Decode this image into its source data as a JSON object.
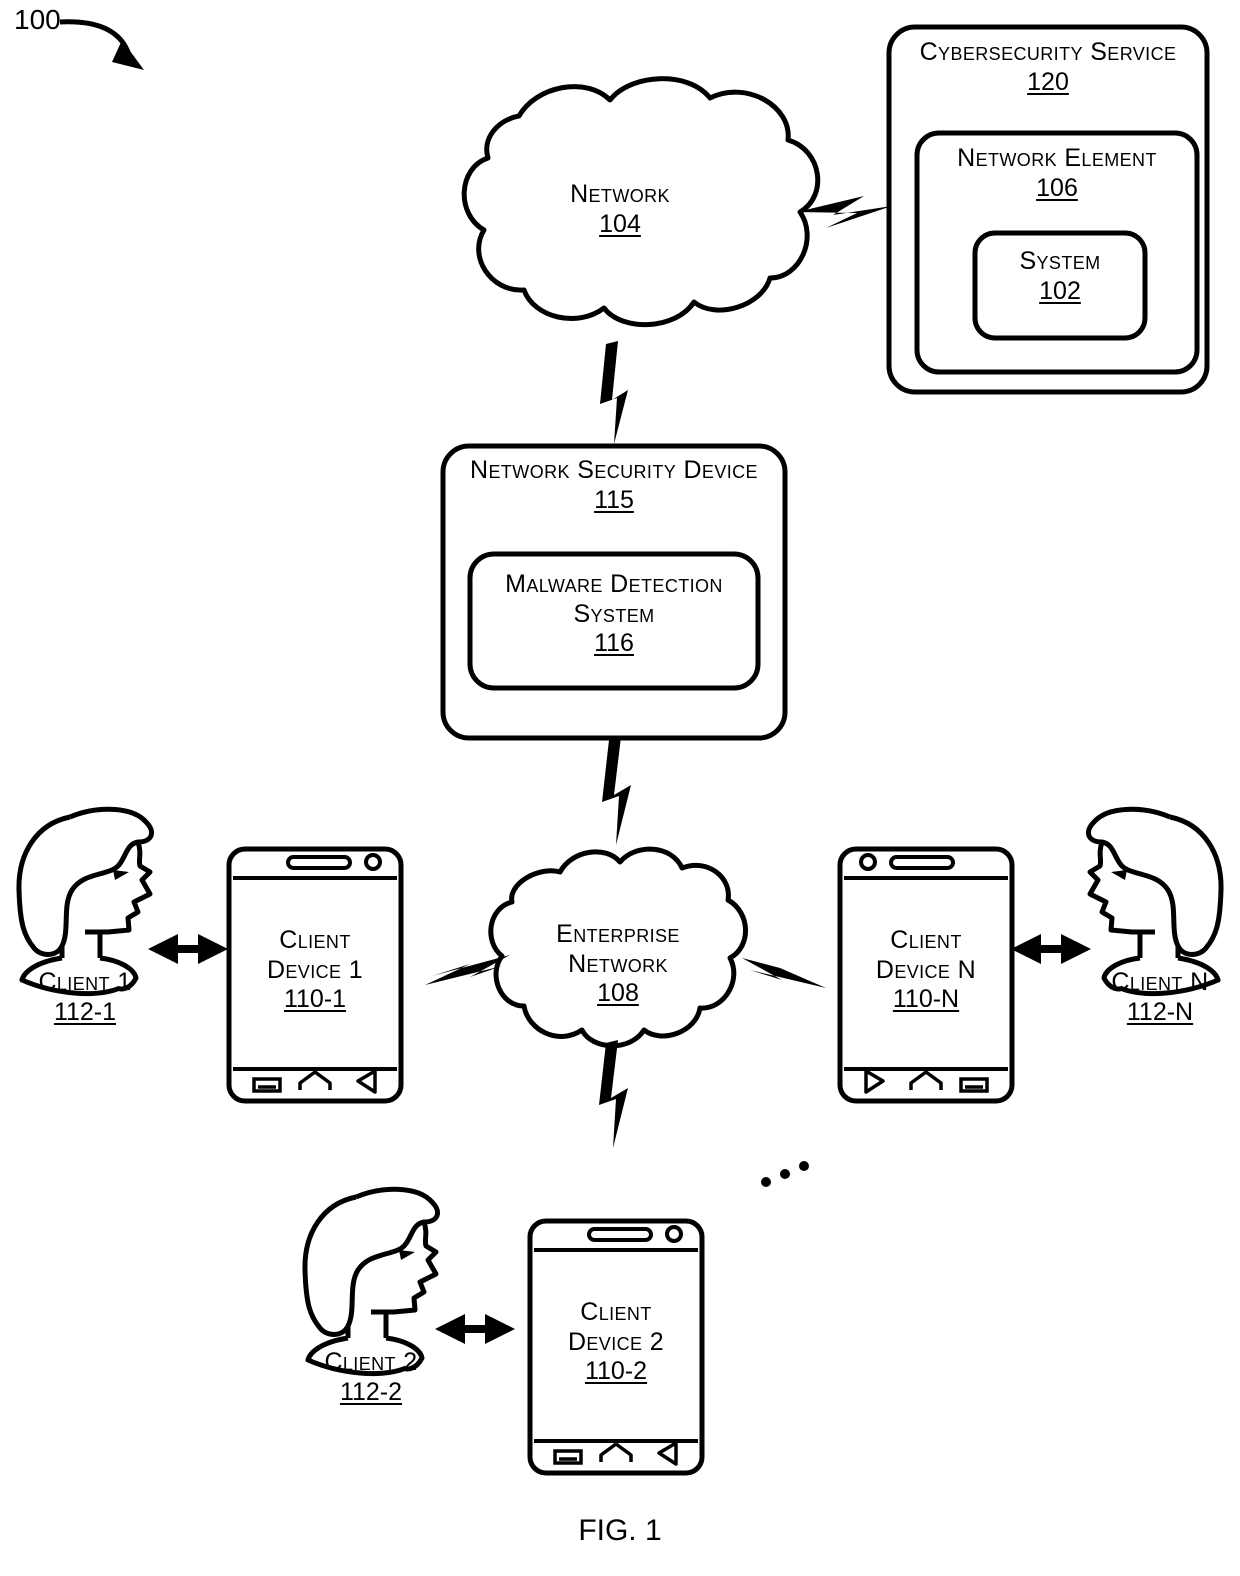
{
  "figure": {
    "caption": "FIG. 1",
    "system_ref": "100"
  },
  "nodes": {
    "network_cloud": {
      "title": "Network",
      "ref": "104",
      "shape": "cloud"
    },
    "cybersecurity_service": {
      "title": "Cybersecurity Service",
      "ref": "120",
      "shape": "rounded-box"
    },
    "network_element": {
      "title": "Network Element",
      "ref": "106",
      "shape": "rounded-box"
    },
    "system": {
      "title": "System",
      "ref": "102",
      "shape": "rounded-box"
    },
    "network_security_device": {
      "title": "Network Security Device",
      "ref": "115",
      "shape": "rounded-box"
    },
    "malware_detection_system": {
      "title_line1": "Malware Detection",
      "title_line2": "System",
      "ref": "116",
      "shape": "rounded-box"
    },
    "enterprise_network": {
      "title_line1": "Enterprise",
      "title_line2": "Network",
      "ref": "108",
      "shape": "cloud"
    },
    "client_device_1": {
      "title_line1": "Client",
      "title_line2": "Device 1",
      "ref": "110-1",
      "shape": "smartphone"
    },
    "client_device_2": {
      "title_line1": "Client",
      "title_line2": "Device 2",
      "ref": "110-2",
      "shape": "smartphone"
    },
    "client_device_n": {
      "title_line1": "Client",
      "title_line2": "Device N",
      "ref": "110-N",
      "shape": "smartphone"
    },
    "client_1": {
      "title": "Client 1",
      "ref": "112-1",
      "shape": "person-profile"
    },
    "client_2": {
      "title": "Client 2",
      "ref": "112-2",
      "shape": "person-profile"
    },
    "client_n": {
      "title": "Client N",
      "ref": "112-N",
      "shape": "person-profile"
    }
  },
  "connectors": {
    "network_to_cybersecurity": "lightning",
    "network_to_security_device": "lightning",
    "security_device_to_enterprise": "lightning",
    "enterprise_to_device_1": "lightning",
    "enterprise_to_device_n": "lightning",
    "enterprise_to_device_2": "lightning",
    "client_1_to_device_1": "double-arrow",
    "client_2_to_device_2": "double-arrow",
    "client_n_to_device_n": "double-arrow",
    "more_devices": "ellipsis"
  },
  "style": {
    "line_color": "#000000",
    "background": "#ffffff"
  }
}
